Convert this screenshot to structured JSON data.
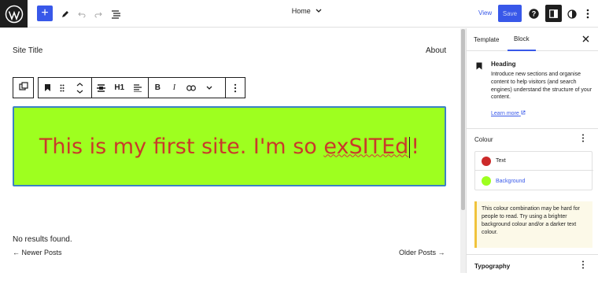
{
  "topbar": {
    "add_label": "+",
    "document_title": "Home",
    "view_label": "View",
    "save_label": "Save",
    "help_label": "?"
  },
  "canvas": {
    "site_title": "Site Title",
    "nav_link": "About",
    "toolbar": {
      "heading_level": "H1",
      "bold": "B",
      "italic": "I"
    },
    "heading": {
      "text_before": "This is my first site. I'm so ",
      "misspelled": "exSITEd",
      "text_after": "!",
      "text_color": "#c93a2a",
      "background_color": "#9eff1f"
    },
    "no_results": "No results found.",
    "newer_posts": "← Newer Posts",
    "older_posts": "Older Posts →"
  },
  "sidebar": {
    "tabs": [
      "Template",
      "Block"
    ],
    "active_tab": "Block",
    "block_card": {
      "title": "Heading",
      "description": "Introduce new sections and organise content to help visitors (and search engines) understand the structure of your content.",
      "learn_more": "Learn more"
    },
    "colour": {
      "title": "Colour",
      "items": [
        {
          "label": "Text",
          "color": "#cc2a2a"
        },
        {
          "label": "Background",
          "color": "#9eff1f"
        }
      ],
      "warning": "This colour combination may be hard for people to read. Try using a brighter background colour and/or a darker text colour."
    },
    "typography_title": "Typography"
  },
  "colors": {
    "accent": "#3858e9",
    "dark": "#1e1e1e"
  }
}
